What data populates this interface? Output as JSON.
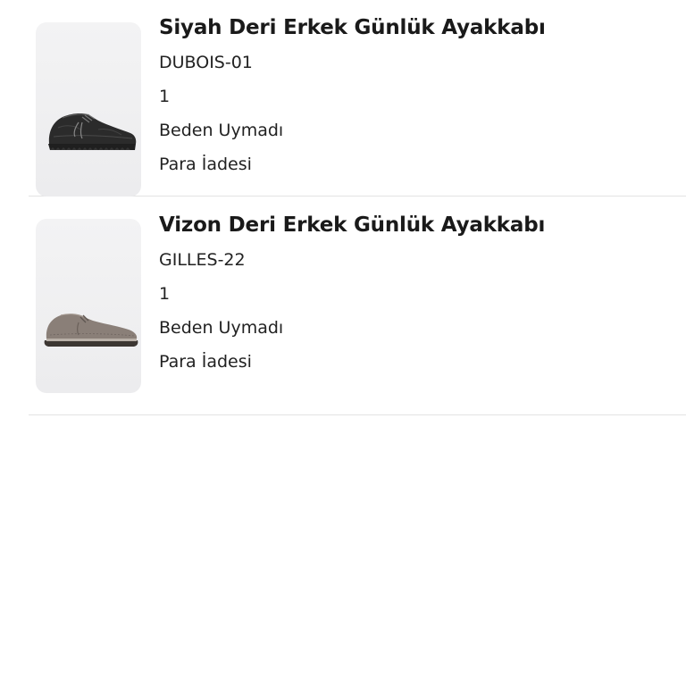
{
  "returns": {
    "items": [
      {
        "name": "Siyah Deri Erkek Günlük Ayakkabı",
        "code": "DUBOIS-01",
        "quantity": "1",
        "reason": "Beden Uymadı",
        "resolution": "Para İadesi",
        "image": "black-leather-casual-shoe",
        "image_bg": "#efeff0",
        "shoe_color": "#2b2b2b"
      },
      {
        "name": "Vizon Deri Erkek Günlük Ayakkabı",
        "code": "GILLES-22",
        "quantity": "1",
        "reason": "Beden Uymadı",
        "resolution": "Para İadesi",
        "image": "mink-suede-casual-shoe",
        "image_bg": "#efeff0",
        "shoe_color": "#8a7f78"
      }
    ]
  }
}
